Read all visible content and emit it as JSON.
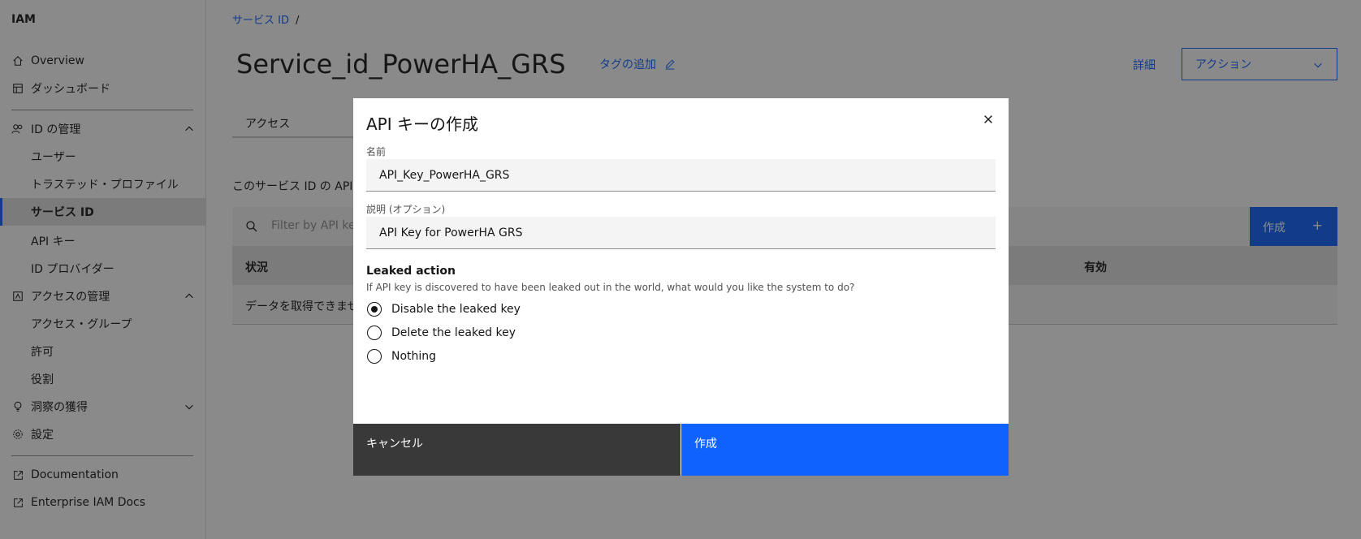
{
  "sidebar": {
    "title": "IAM",
    "overview": "Overview",
    "dashboard": "ダッシュボード",
    "id_management": "ID の管理",
    "users": "ユーザー",
    "trusted_profiles": "トラステッド・プロファイル",
    "service_id": "サービス ID",
    "api_keys": "API キー",
    "id_providers": "ID プロバイダー",
    "access_management": "アクセスの管理",
    "access_groups": "アクセス・グループ",
    "permissions": "許可",
    "roles": "役割",
    "insights": "洞察の獲得",
    "settings": "設定",
    "documentation": "Documentation",
    "enterprise_docs": "Enterprise IAM Docs"
  },
  "breadcrumb": {
    "item": "サービス ID",
    "sep": "/"
  },
  "page": {
    "title": "Service_id_PowerHA_GRS",
    "add_tag": "タグの追加",
    "details": "詳細",
    "actions": "アクション",
    "tab_access": "アクセス",
    "section_text": "このサービス ID の API",
    "filter_placeholder": "Filter by API key",
    "create": "作成",
    "col_status": "状況",
    "col_valid": "有効",
    "empty_row": "データを取得できませ"
  },
  "modal": {
    "title": "API キーの作成",
    "name_label": "名前",
    "name_value": "API_Key_PowerHA_GRS",
    "desc_label": "説明 (オプション)",
    "desc_value": "API Key for PowerHA GRS",
    "leaked_title": "Leaked action",
    "leaked_desc": "If API key is discovered to have been leaked out in the world, what would you like the system to do?",
    "options": [
      "Disable the leaked key",
      "Delete the leaked key",
      "Nothing"
    ],
    "selected_option": 0,
    "cancel": "キャンセル",
    "create": "作成"
  },
  "colors": {
    "primary": "#0f62fe",
    "dark": "#393939",
    "overlay": "rgba(22,22,22,0.5)"
  }
}
